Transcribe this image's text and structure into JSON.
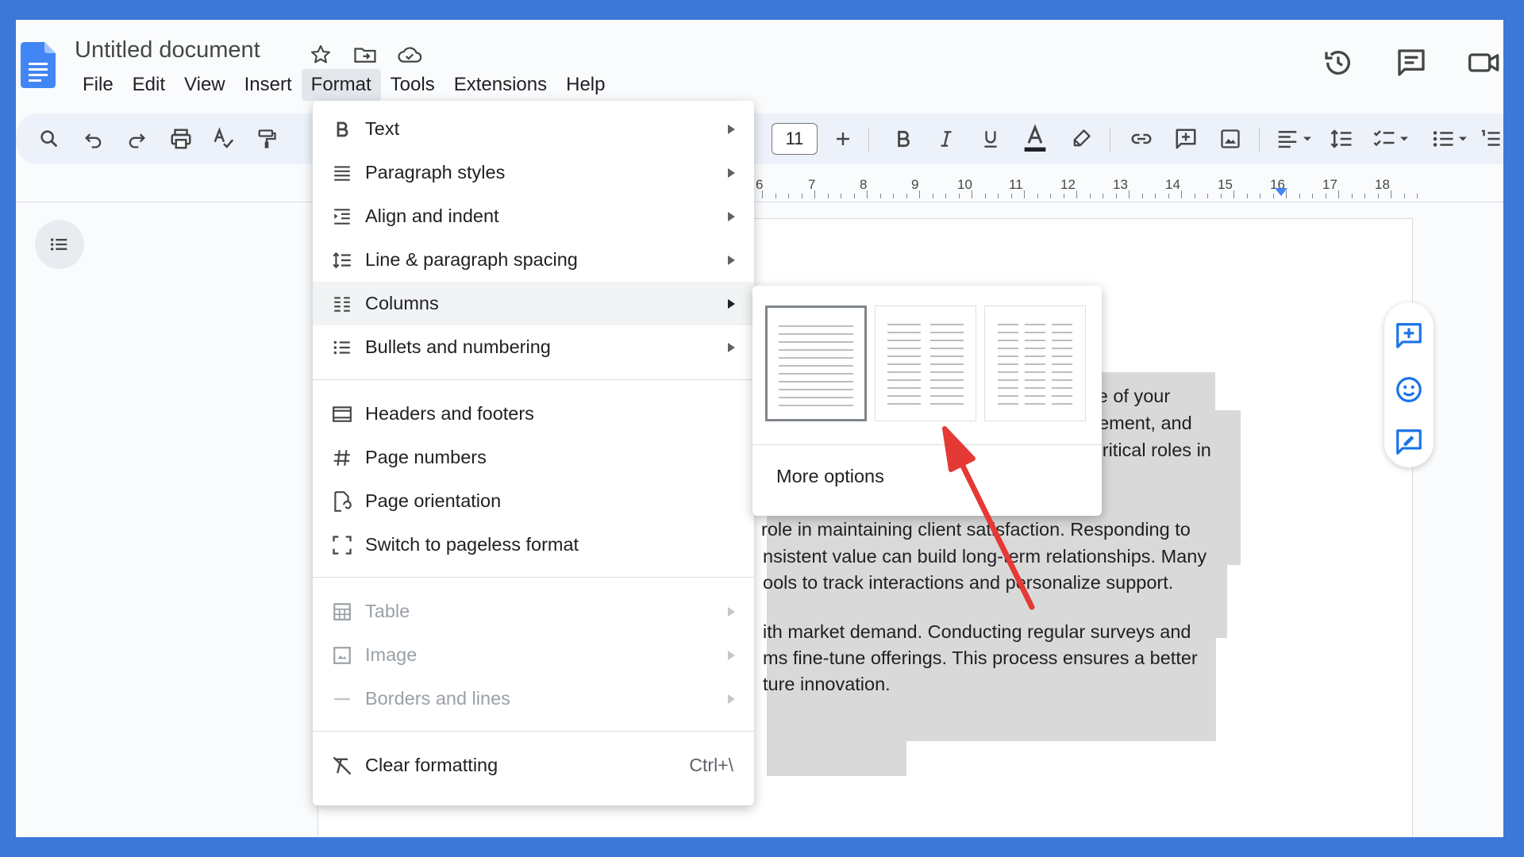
{
  "header": {
    "title": "Untitled document",
    "menus": [
      "File",
      "Edit",
      "View",
      "Insert",
      "Format",
      "Tools",
      "Extensions",
      "Help"
    ],
    "active_menu": "Format"
  },
  "toolbar": {
    "font_size": "11"
  },
  "ruler": {
    "numbers": [
      "6",
      "7",
      "8",
      "9",
      "10",
      "11",
      "12",
      "13",
      "14",
      "15",
      "16",
      "17",
      "18"
    ]
  },
  "document": {
    "lines": [
      "ze of your",
      "gement, and",
      "critical roles in",
      "role in maintaining client satisfaction. Responding to",
      "nsistent value can build long-term relationships. Many",
      "ools to track interactions and personalize support.",
      "ith market demand. Conducting regular surveys and",
      "ms fine-tune offerings. This process ensures a better",
      "ture innovation."
    ]
  },
  "format_menu": {
    "items": [
      {
        "label": "Text",
        "icon": "bold-b-icon",
        "submenu": true
      },
      {
        "label": "Paragraph styles",
        "icon": "paragraph-lines-icon",
        "submenu": true
      },
      {
        "label": "Align and indent",
        "icon": "indent-icon",
        "submenu": true
      },
      {
        "label": "Line & paragraph spacing",
        "icon": "line-spacing-icon",
        "submenu": true
      },
      {
        "label": "Columns",
        "icon": "columns-icon",
        "submenu": true
      },
      {
        "label": "Bullets and numbering",
        "icon": "bulleted-list-icon",
        "submenu": true
      },
      {
        "label": "Headers and footers",
        "icon": "header-footer-icon",
        "submenu": false
      },
      {
        "label": "Page numbers",
        "icon": "hash-icon",
        "submenu": false
      },
      {
        "label": "Page orientation",
        "icon": "page-orientation-icon",
        "submenu": false
      },
      {
        "label": "Switch to pageless format",
        "icon": "pageless-icon",
        "submenu": false
      },
      {
        "label": "Table",
        "icon": "table-icon",
        "submenu": true,
        "disabled": true
      },
      {
        "label": "Image",
        "icon": "image-icon",
        "submenu": true,
        "disabled": true
      },
      {
        "label": "Borders and lines",
        "icon": "border-line-icon",
        "submenu": true,
        "disabled": true
      },
      {
        "label": "Clear formatting",
        "icon": "clear-format-icon",
        "submenu": false,
        "shortcut": "Ctrl+\\"
      }
    ]
  },
  "columns_submenu": {
    "options": [
      "one-column",
      "two-columns",
      "three-columns"
    ],
    "selected": "one-column",
    "more_options": "More options"
  },
  "colors": {
    "frame_border": "#3b78d8",
    "toolbar_bg": "#edf2fa",
    "selection_highlight": "#d9d9d9",
    "annotation_arrow": "#e53935",
    "docs_blue": "#4285f4"
  }
}
